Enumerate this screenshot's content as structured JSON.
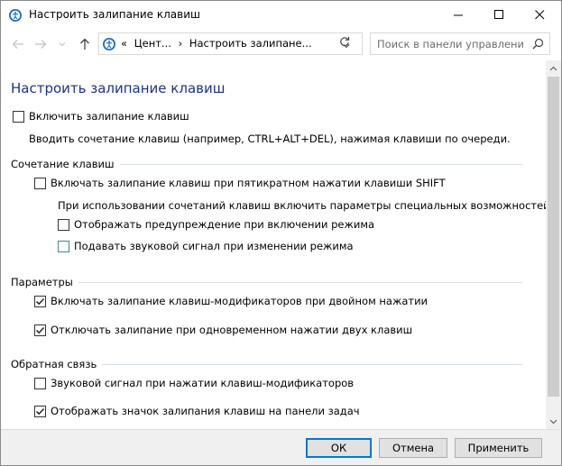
{
  "window": {
    "title": "Настроить залипание клавиш"
  },
  "address": {
    "prefix": "«",
    "crumb1": "Цент...",
    "separator": "›",
    "crumb2": "Настроить залипане..."
  },
  "search": {
    "placeholder": "Поиск в панели управления"
  },
  "page": {
    "title": "Настроить залипание клавиш",
    "enable_label": "Включить залипание клавиш",
    "enable_checked": false,
    "description": "Вводить сочетание клавиш (например, CTRL+ALT+DEL), нажимая клавиши по очереди."
  },
  "groups": {
    "shortcut": {
      "header": "Сочетание клавиш",
      "shift_label": "Включать залипание клавиш при пятикратном нажатии клавиши SHIFT",
      "shift_checked": false,
      "note": "При использовании сочетаний клавиш включить параметры специальных возможностей:",
      "warning_label": "Отображать предупреждение при включении режима",
      "warning_checked": false,
      "sound_label": "Подавать звуковой сигнал при изменении режима",
      "sound_checked": false
    },
    "options": {
      "header": "Параметры",
      "double_label": "Включать залипание клавиш-модификаторов при двойном нажатии",
      "double_checked": true,
      "two_keys_label": "Отключать залипание при одновременном нажатии двух клавиш",
      "two_keys_checked": true
    },
    "feedback": {
      "header": "Обратная связь",
      "beep_label": "Звуковой сигнал при нажатии клавиш-модификаторов",
      "beep_checked": false,
      "taskbar_label": "Отображать значок залипания клавиш на панели задач",
      "taskbar_checked": true
    }
  },
  "buttons": {
    "ok": "ОК",
    "cancel": "Отмена",
    "apply": "Применить"
  },
  "colors": {
    "title_blue": "#1e3287",
    "default_button_border": "#0078d7"
  }
}
